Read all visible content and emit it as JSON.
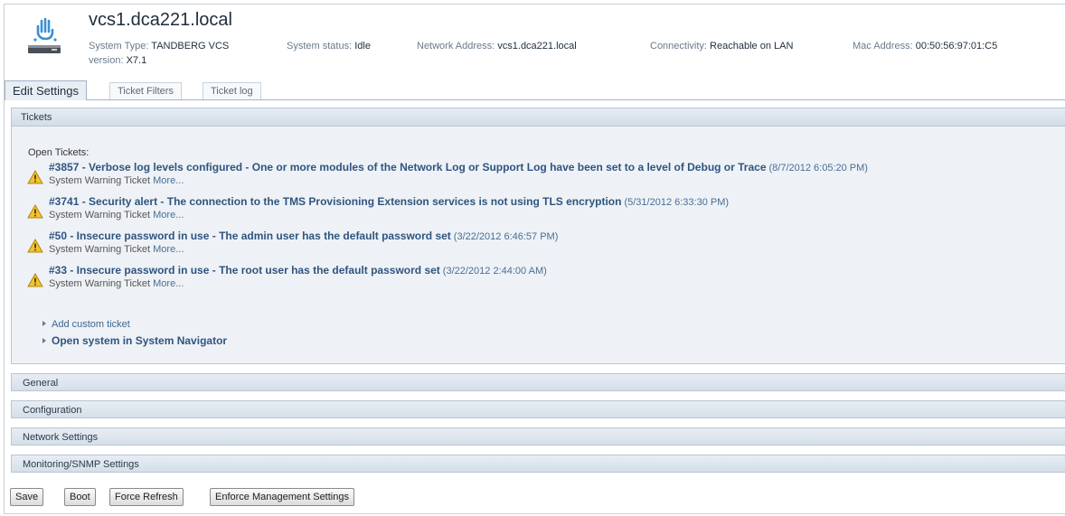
{
  "header": {
    "title": "vcs1.dca221.local",
    "system_type_label": "System Type:",
    "system_type": "TANDBERG VCS",
    "status_label": "System status:",
    "status": "Idle",
    "network_label": "Network Address:",
    "network": "vcs1.dca221.local",
    "connectivity_label": "Connectivity:",
    "connectivity": "Reachable on LAN",
    "mac_label": "Mac Address:",
    "mac": "00:50:56:97:01:C5",
    "version_label": "version:",
    "version": "X7.1",
    "icon": "server-device-icon"
  },
  "tabs": [
    {
      "label": "Edit Settings",
      "active": true
    },
    {
      "label": "Ticket Filters",
      "active": false
    },
    {
      "label": "Ticket log",
      "active": false
    }
  ],
  "tickets_panel": {
    "title": "Tickets",
    "open_label": "Open Tickets:",
    "items": [
      {
        "title": "#3857 - Verbose log levels configured - One or more modules of the Network Log or Support Log have been set to a level of Debug or Trace",
        "date": "(8/7/2012 6:05:20 PM)",
        "type": "System Warning Ticket",
        "more": "More..."
      },
      {
        "title": "#3741 - Security alert - The connection to the TMS Provisioning Extension services is not using TLS encryption",
        "date": "(5/31/2012 6:33:30 PM)",
        "type": "System Warning Ticket",
        "more": "More..."
      },
      {
        "title": "#50 - Insecure password in use - The admin user has the default password set",
        "date": "(3/22/2012 6:46:57 PM)",
        "type": "System Warning Ticket",
        "more": "More..."
      },
      {
        "title": "#33 - Insecure password in use - The root user has the default password set",
        "date": "(3/22/2012 2:44:00 AM)",
        "type": "System Warning Ticket",
        "more": "More..."
      }
    ],
    "add_custom": "Add custom ticket",
    "open_navigator": "Open system in System Navigator"
  },
  "sections": [
    "General",
    "Configuration",
    "Network Settings",
    "Monitoring/SNMP Settings"
  ],
  "buttons": {
    "save": "Save",
    "boot": "Boot",
    "force_refresh": "Force Refresh",
    "enforce": "Enforce Management Settings"
  },
  "colors": {
    "link": "#2f5480",
    "warning": "#f2c230",
    "panel_bg": "#eef2f6"
  }
}
